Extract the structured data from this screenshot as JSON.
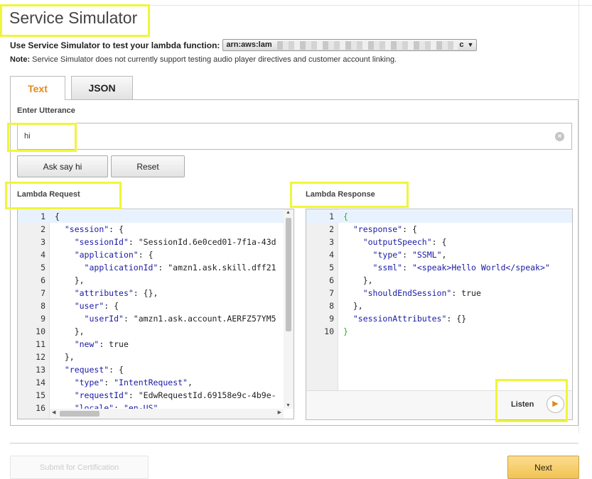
{
  "header": {
    "title": "Service Simulator"
  },
  "lambda": {
    "label": "Use Service Simulator to test your lambda function:",
    "arn_prefix": "arn:aws:lam",
    "arn_suffix": "c",
    "arrow": "▼"
  },
  "note": {
    "label": "Note:",
    "text": "Service Simulator does not currently support testing audio player directives and customer account linking."
  },
  "tabs": [
    {
      "label": "Text",
      "active": true
    },
    {
      "label": "JSON",
      "active": false
    }
  ],
  "utterance": {
    "label": "Enter Utterance",
    "value": "hi"
  },
  "buttons": {
    "ask": "Ask say hi",
    "reset": "Reset",
    "listen": "Listen",
    "submit": "Submit for Certification",
    "next": "Next"
  },
  "request": {
    "title": "Lambda Request",
    "lines": [
      {
        "n": "1",
        "t": "{"
      },
      {
        "n": "2",
        "t": "  \"session\": {"
      },
      {
        "n": "3",
        "t": "    \"sessionId\": \"SessionId.6e0ced01-7f1a-43d"
      },
      {
        "n": "4",
        "t": "    \"application\": {"
      },
      {
        "n": "5",
        "t": "      \"applicationId\": \"amzn1.ask.skill.dff21"
      },
      {
        "n": "6",
        "t": "    },"
      },
      {
        "n": "7",
        "t": "    \"attributes\": {},"
      },
      {
        "n": "8",
        "t": "    \"user\": {"
      },
      {
        "n": "9",
        "t": "      \"userId\": \"amzn1.ask.account.AERFZ57YM5"
      },
      {
        "n": "10",
        "t": "    },"
      },
      {
        "n": "11",
        "t": "    \"new\": true"
      },
      {
        "n": "12",
        "t": "  },"
      },
      {
        "n": "13",
        "t": "  \"request\": {"
      },
      {
        "n": "14",
        "t": "    \"type\": \"IntentRequest\","
      },
      {
        "n": "15",
        "t": "    \"requestId\": \"EdwRequestId.69158e9c-4b9e-"
      },
      {
        "n": "16",
        "t": "    \"locale\": \"en-US\","
      }
    ]
  },
  "response": {
    "title": "Lambda Response",
    "lines": [
      {
        "n": "1",
        "t": "{"
      },
      {
        "n": "2",
        "t": "  \"response\": {"
      },
      {
        "n": "3",
        "t": "    \"outputSpeech\": {"
      },
      {
        "n": "4",
        "t": "      \"type\": \"SSML\","
      },
      {
        "n": "5",
        "t": "      \"ssml\": \"<speak>Hello World</speak>\""
      },
      {
        "n": "6",
        "t": "    },"
      },
      {
        "n": "7",
        "t": "    \"shouldEndSession\": true"
      },
      {
        "n": "8",
        "t": "  },"
      },
      {
        "n": "9",
        "t": "  \"sessionAttributes\": {}"
      },
      {
        "n": "10",
        "t": "}"
      }
    ]
  },
  "icons": {
    "clear": "clear-icon",
    "play": "play-icon"
  },
  "colors": {
    "highlight": "#f0f53a",
    "accent": "#e28a1a",
    "next_button": "#f2c353"
  }
}
